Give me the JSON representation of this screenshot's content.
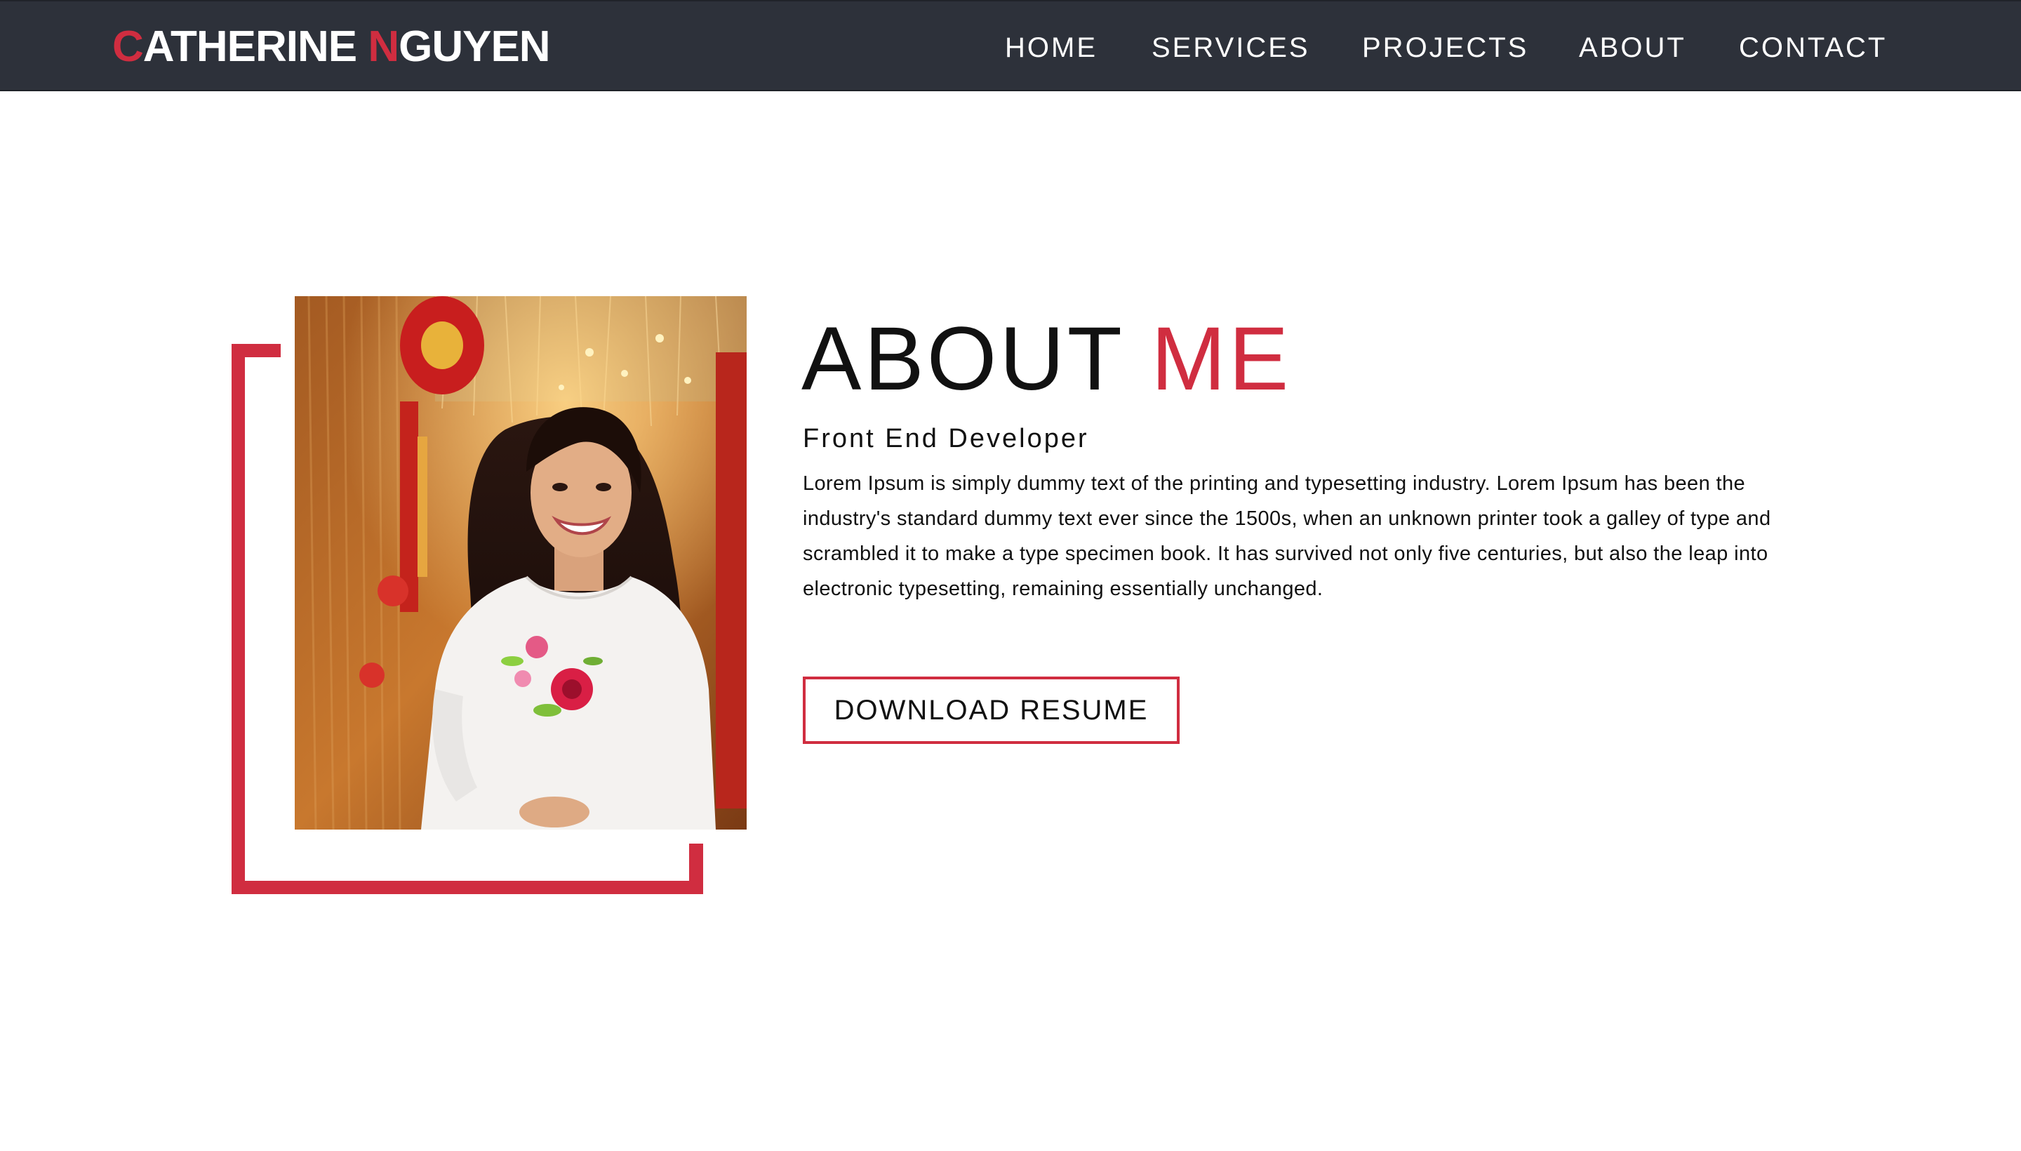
{
  "navbar": {
    "brand": {
      "first_initial": "C",
      "first_rest": "ATHERINE ",
      "last_initial": "N",
      "last_rest": "GUYEN"
    },
    "links": [
      {
        "label": "HOME"
      },
      {
        "label": "SERVICES"
      },
      {
        "label": "PROJECTS"
      },
      {
        "label": "ABOUT"
      },
      {
        "label": "CONTACT"
      }
    ]
  },
  "about": {
    "title_main": "ABOUT ",
    "title_accent": "ME",
    "subtitle": "Front End Developer",
    "bio": "Lorem Ipsum is simply dummy text of the printing and typesetting industry. Lorem Ipsum has been the industry's standard dummy text ever since the 1500s, when an unknown printer took a galley of type and scrambled it to make a type specimen book. It has survived not only five centuries, but also the leap into electronic typesetting, remaining essentially unchanged.",
    "resume_button": "DOWNLOAD RESUME"
  },
  "colors": {
    "accent": "#d02d40",
    "navbar_bg": "#2d313a",
    "text": "#111111",
    "page_bg": "#ffffff"
  }
}
